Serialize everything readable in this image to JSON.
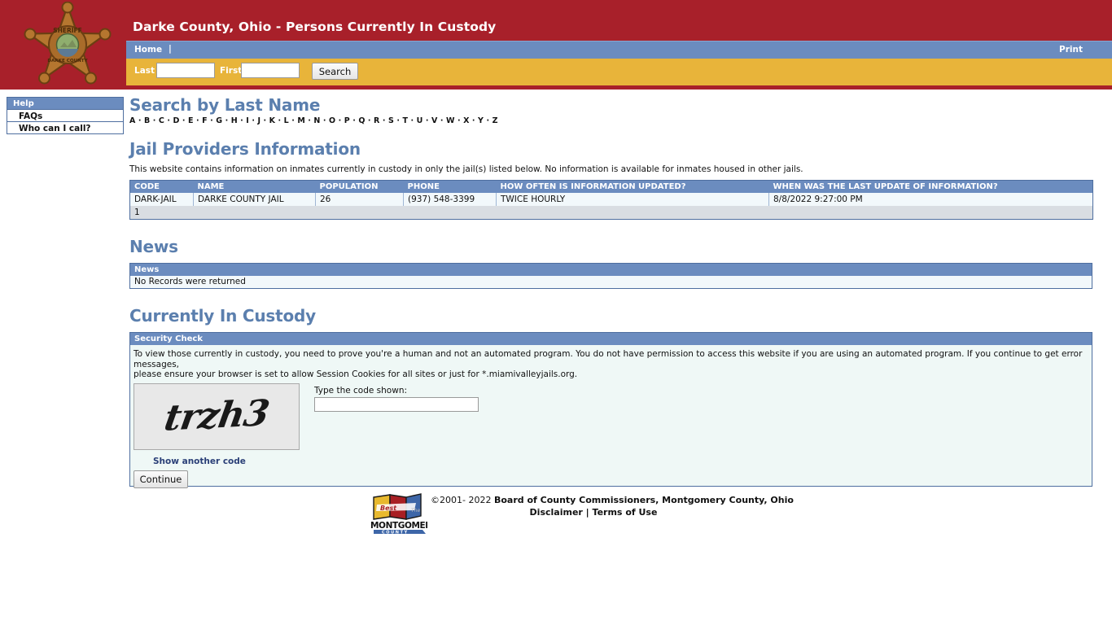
{
  "header": {
    "title": "Darke County, Ohio - Persons Currently In Custody",
    "badge_icon": "sheriff-star-badge-icon",
    "badge_text_top": "SHERIFF",
    "badge_text_bottom": "DARKE COUNTY",
    "nav": {
      "home_label": "Home",
      "separator": "|",
      "print_label": "Print"
    },
    "search": {
      "last_label": "Last",
      "last_value": "",
      "first_label": "First",
      "first_value": "",
      "button_label": "Search"
    }
  },
  "sidebar": {
    "heading": "Help",
    "items": [
      {
        "label": "FAQs"
      },
      {
        "label": "Who can I call?"
      }
    ]
  },
  "main": {
    "search_by_last_name": {
      "title": "Search by Last Name",
      "letters": [
        "A",
        "B",
        "C",
        "D",
        "E",
        "F",
        "G",
        "H",
        "I",
        "J",
        "K",
        "L",
        "M",
        "N",
        "O",
        "P",
        "Q",
        "R",
        "S",
        "T",
        "U",
        "V",
        "W",
        "X",
        "Y",
        "Z"
      ],
      "separator": "·"
    },
    "jail_providers": {
      "title": "Jail Providers Information",
      "description": "This website contains information on inmates currently in custody in only the jail(s) listed below. No information is available for inmates housed in other jails.",
      "columns": [
        "CODE",
        "NAME",
        "POPULATION",
        "PHONE",
        "HOW OFTEN IS INFORMATION UPDATED?",
        "WHEN WAS THE LAST UPDATE OF INFORMATION?"
      ],
      "rows": [
        {
          "code": "DARK-JAIL",
          "name": "DARKE COUNTY JAIL",
          "population": "26",
          "phone": "(937) 548-3399",
          "update_frequency": "TWICE HOURLY",
          "last_update": "8/8/2022 9:27:00 PM"
        }
      ],
      "pager": "1"
    },
    "news": {
      "title": "News",
      "column": "News",
      "empty_message": "No Records were returned"
    },
    "custody": {
      "title": "Currently In Custody",
      "panel_heading": "Security Check",
      "instructions_line1": "To view those currently in custody, you need to prove you're a human and not an automated program. You do not have permission to access this website if you are using an automated program. If you continue to get error messages,",
      "instructions_line2": "please ensure your browser is set to allow Session Cookies for all sites or just for *.miamivalleyjails.org.",
      "captcha_code": "trzh3",
      "code_label": "Type the code shown:",
      "code_value": "",
      "show_another_label": "Show another code",
      "continue_label": "Continue"
    }
  },
  "footer": {
    "logo_icon": "montgomery-county-flags-logo",
    "logo_text_main": "MONTGOMERY",
    "logo_text_sub": "C O U N T Y",
    "copyright_prefix": "©2001- 2022 ",
    "copyright_entity": "Board of County Commissioners, Montgomery County, Ohio",
    "disclaimer_label": "Disclaimer",
    "links_separator": "|",
    "terms_label": "Terms of Use"
  },
  "colors": {
    "header_red": "#a8202a",
    "nav_blue": "#6b8cbf",
    "search_gold": "#e8b43a",
    "heading_blue": "#5b7fae",
    "table_row_bg": "#f2f8fb",
    "panel_bg": "#eff8f6",
    "pager_bg": "#d9dde2"
  }
}
